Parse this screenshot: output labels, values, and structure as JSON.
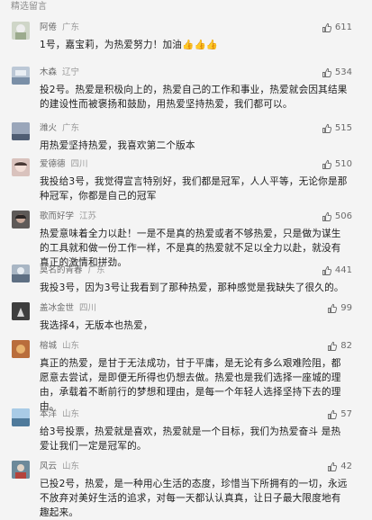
{
  "section_title": "精选留言",
  "comments": [
    {
      "name": "阿倦",
      "location": "广东",
      "likes": "611",
      "text": "1号，嘉宝莉，为热爱努力！加油👍👍👍",
      "avatar_color": "#cfd6c8"
    },
    {
      "name": "木森",
      "location": "辽宁",
      "likes": "534",
      "text": "投2号。热爱是积极向上的，热爱自己的工作和事业，热爱就会因其结果的建设性而被褒扬和鼓励，用热爱坚持热爱，我们都可以。",
      "avatar_color": "#bcc8d6"
    },
    {
      "name": "潍火",
      "location": "广东",
      "likes": "515",
      "text": "用热爱坚持热爱，我喜欢第二个版本",
      "avatar_color": "#9aa6ba"
    },
    {
      "name": "爱德德",
      "location": "四川",
      "likes": "510",
      "text": "我投给3号，我觉得宣言特别好，我们都是冠军，人人平等，无论你是那种冠军，你都是自己的冠军",
      "avatar_color": "#d9c2bd"
    },
    {
      "name": "歌而好学",
      "location": "江苏",
      "likes": "506",
      "text": "热爱意味着全力以赴！一是不是真的热爱或者不够热爱，只是做为谋生的工具就和做一份工作一样，不是真的热爱就不足以全力以赴，就没有真正的激情和拼劲。",
      "avatar_color": "#5e5a58"
    },
    {
      "name": "莫名的青春",
      "location": "广东",
      "likes": "441",
      "text": "我投3号，因为3号让我看到了那种热爱，那种感觉是我缺失了很久的。",
      "avatar_color": "#a9b6c4"
    },
    {
      "name": "盖冰金世",
      "location": "四川",
      "likes": "99",
      "text": "我选择4，无版本也热爱，",
      "avatar_color": "#3e3e3e"
    },
    {
      "name": "榕城",
      "location": "山东",
      "likes": "82",
      "text": "真正的热爱，是甘于无法成功，甘于平庸，是无论有多么艰难险阻，都愿意去尝试，是即便无所得也仍想去做。热爱也是我们选择一座城的理由，承载着不断前行的梦想和理由，是每一个年轻人选择坚持下去的理由。",
      "avatar_color": "#b96d3c"
    },
    {
      "name": "本洋",
      "location": "山东",
      "likes": "57",
      "text": "给3号投票，热爱就是喜欢，热爱就是一个目标，我们为热爱奋斗 是热爱让我们一定是冠军的。",
      "avatar_color": "#7ea7c9"
    },
    {
      "name": "风云",
      "location": "山东",
      "likes": "42",
      "text": "已投2号，热爱，是一种用心生活的态度，珍惜当下所拥有的一切，永远不放弃对美好生活的追求，对每一天都认认真真，让日子最大限度地有趣起来。",
      "avatar_color": "#6d8a9a"
    }
  ]
}
